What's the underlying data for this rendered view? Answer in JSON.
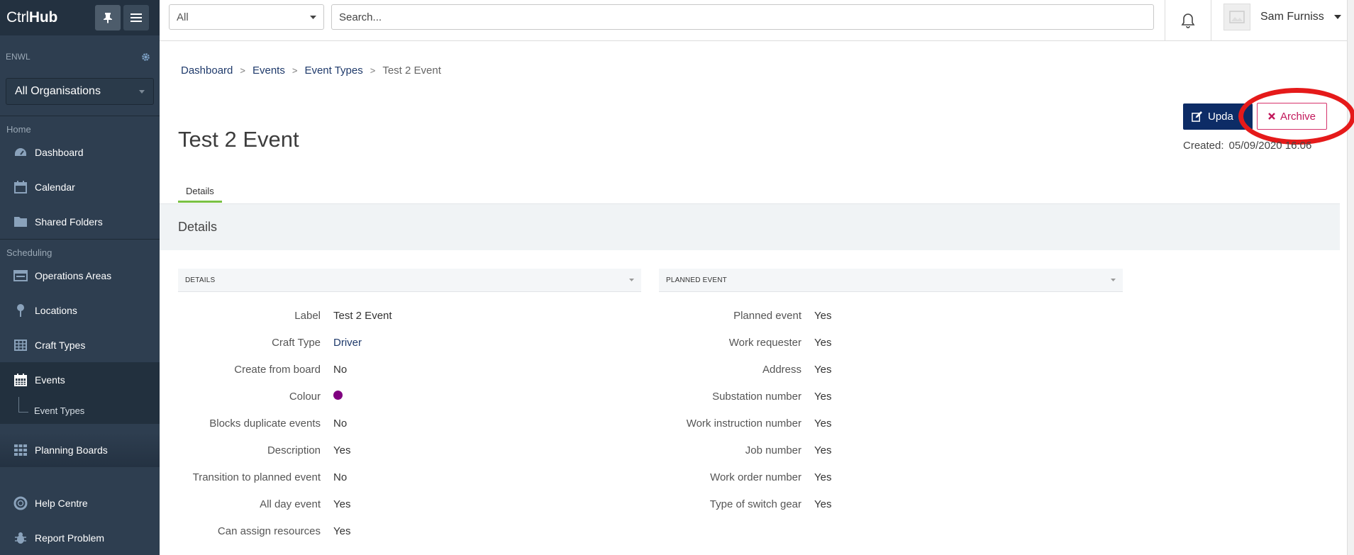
{
  "sidebar": {
    "logo_light": "Ctrl",
    "logo_bold": "Hub",
    "org_code": "ENWL",
    "org_select": "All Organisations",
    "sections": {
      "home": "Home",
      "scheduling": "Scheduling"
    },
    "items": {
      "dashboard": "Dashboard",
      "calendar": "Calendar",
      "shared_folders": "Shared Folders",
      "operations_areas": "Operations Areas",
      "locations": "Locations",
      "craft_types": "Craft Types",
      "events": "Events",
      "event_types": "Event Types",
      "planning_boards": "Planning Boards",
      "help_centre": "Help Centre",
      "report_problem": "Report Problem"
    }
  },
  "topbar": {
    "scope": "All",
    "search_placeholder": "Search...",
    "user_name": "Sam Furniss"
  },
  "breadcrumb": [
    "Dashboard",
    "Events",
    "Event Types",
    "Test 2 Event"
  ],
  "page": {
    "title": "Test 2 Event",
    "update_label": "Upda",
    "archive_label": "Archive",
    "created_label": "Created:",
    "created_value": "05/09/2020 16:06",
    "tab": "Details",
    "panel_title": "Details"
  },
  "details": {
    "heading": "DETAILS",
    "rows": [
      {
        "k": "Label",
        "v": "Test 2 Event"
      },
      {
        "k": "Craft Type",
        "v": "Driver"
      },
      {
        "k": "Create from board",
        "v": "No"
      },
      {
        "k": "Colour",
        "v": ""
      },
      {
        "k": "Blocks duplicate events",
        "v": "No"
      },
      {
        "k": "Description",
        "v": "Yes"
      },
      {
        "k": "Transition to planned event",
        "v": "No"
      },
      {
        "k": "All day event",
        "v": "Yes"
      },
      {
        "k": "Can assign resources",
        "v": "Yes"
      }
    ]
  },
  "planned": {
    "heading": "PLANNED EVENT",
    "rows": [
      {
        "k": "Planned event",
        "v": "Yes"
      },
      {
        "k": "Work requester",
        "v": "Yes"
      },
      {
        "k": "Address",
        "v": "Yes"
      },
      {
        "k": "Substation number",
        "v": "Yes"
      },
      {
        "k": "Work instruction number",
        "v": "Yes"
      },
      {
        "k": "Job number",
        "v": "Yes"
      },
      {
        "k": "Work order number",
        "v": "Yes"
      },
      {
        "k": "Type of switch gear",
        "v": "Yes"
      }
    ]
  },
  "colors": {
    "event_colour": "#800080",
    "sidebar_bg": "#2e3e50",
    "update_button": "#0d2c66",
    "archive_accent": "#c2185b",
    "tab_underline": "#7ac143",
    "annotation": "#e51a1a"
  }
}
